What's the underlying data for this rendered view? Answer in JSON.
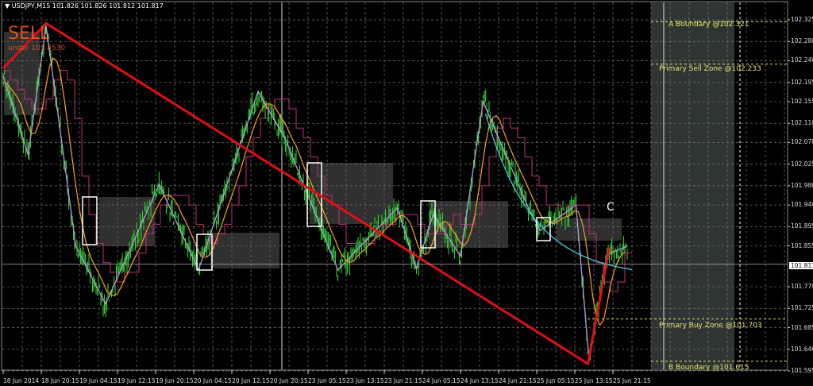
{
  "header": {
    "symbol": "USDJPY,M15",
    "ohlc": "101.826 101.826 101.812 101.817",
    "title_text": "▼ USDJPY,M15  101.826 101.826 101.812 101.817"
  },
  "annotations": {
    "signal": "SELL",
    "signal_sub": "under 101.8530",
    "wave_label": "C",
    "zones": [
      {
        "label": "A Boundary @102.321",
        "price": 102.321
      },
      {
        "label": "Primary Sell Zone @102.233",
        "price": 102.233
      },
      {
        "label": "Primary Buy Zone @101.703",
        "price": 101.703
      },
      {
        "label": "B Boundary @101.615",
        "price": 101.615
      }
    ]
  },
  "colors": {
    "candles": "#2ecc2e",
    "zigzag": "#b39ddb",
    "ma": "#ffa020",
    "step": "#c0307a",
    "curve": "#40c8e0",
    "trend": "#e01010",
    "zone": "#e8e86a"
  },
  "chart_data": {
    "type": "line",
    "title": "USDJPY,M15",
    "current_price": "101.817",
    "ylim": [
      101.595,
      102.325
    ],
    "y_ticks": [
      "102.325",
      "102.280",
      "102.240",
      "102.195",
      "102.155",
      "102.110",
      "102.070",
      "102.025",
      "101.980",
      "101.940",
      "101.895",
      "101.855",
      "101.770",
      "101.725",
      "101.685",
      "101.640",
      "101.595"
    ],
    "x_ticks": [
      "18 Jun 2014",
      "18 Jun 20:15",
      "19 Jun 04:15",
      "19 Jun 12:15",
      "19 Jun 20:15",
      "20 Jun 04:15",
      "20 Jun 12:15",
      "20 Jun 20:15",
      "23 Jun 05:15",
      "23 Jun 13:15",
      "23 Jun 21:15",
      "24 Jun 05:15",
      "24 Jun 13:15",
      "24 Jun 21:15",
      "25 Jun 05:15",
      "25 Jun 13:15",
      "25 Jun 21:15"
    ],
    "bars_per_tick": 32,
    "zigzag": [
      [
        0,
        102.209
      ],
      [
        21,
        102.044
      ],
      [
        36,
        102.313
      ],
      [
        61,
        101.854
      ],
      [
        86,
        101.734
      ],
      [
        131,
        101.983
      ],
      [
        164,
        101.805
      ],
      [
        214,
        102.176
      ],
      [
        237,
        102.077
      ],
      [
        281,
        101.805
      ],
      [
        331,
        101.934
      ],
      [
        347,
        101.808
      ],
      [
        361,
        101.92
      ],
      [
        384,
        101.834
      ],
      [
        403,
        102.155
      ],
      [
        441,
        101.934
      ],
      [
        451,
        101.887
      ],
      [
        481,
        101.94
      ],
      [
        492,
        101.615
      ],
      [
        507,
        101.838
      ],
      [
        524,
        101.854
      ]
    ],
    "trendline": [
      [
        0,
        102.224
      ],
      [
        36,
        102.318
      ],
      [
        491,
        101.61
      ],
      [
        509,
        101.852
      ]
    ]
  }
}
